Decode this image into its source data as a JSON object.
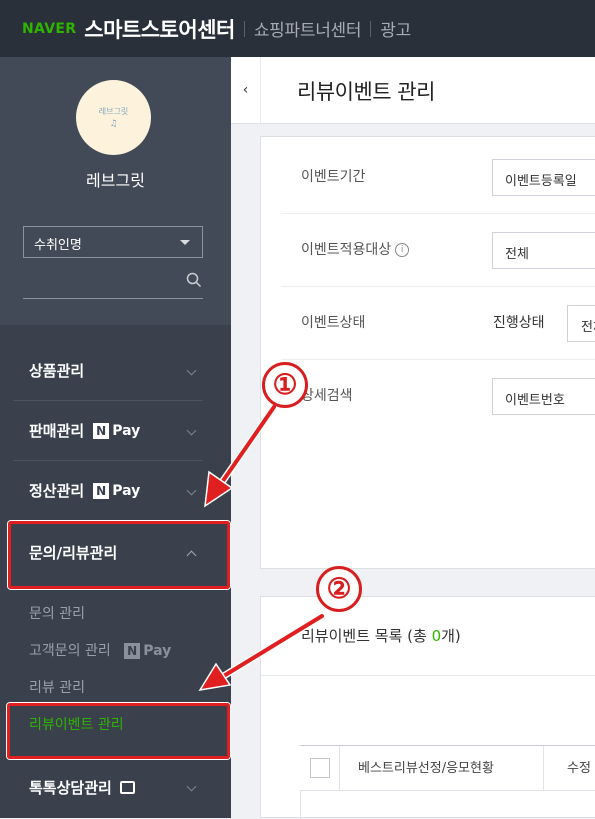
{
  "topbar": {
    "brand": "NAVER",
    "app_name": "스마트스토어센터",
    "links": [
      "쇼핑파트너센터",
      "광고"
    ]
  },
  "sidebar": {
    "avatar_text": "레브그릿",
    "avatar_mark": "♫",
    "store_name": "레브그릿",
    "select_value": "수취인명",
    "menu": [
      {
        "label": "상품관리"
      },
      {
        "label": "판매관리",
        "badge": "Pay"
      },
      {
        "label": "정산관리",
        "badge": "Pay"
      },
      {
        "label": "문의/리뷰관리"
      }
    ],
    "submenu": [
      {
        "label": "문의 관리"
      },
      {
        "label": "고객문의 관리",
        "badge": "Pay"
      },
      {
        "label": "리뷰 관리"
      },
      {
        "label": "리뷰이벤트 관리"
      }
    ],
    "talk_label": "톡톡상담관리",
    "npay_n": "N"
  },
  "main": {
    "collapse_glyph": "‹",
    "page_title": "리뷰이벤트 관리",
    "filters": {
      "period_label": "이벤트기간",
      "period_value": "이벤트등록일",
      "target_label": "이벤트적용대상",
      "target_value": "전체",
      "status_label": "이벤트상태",
      "status_sub_label": "진행상태",
      "status_value": "전체",
      "search_label": "상세검색",
      "search_value": "이벤트번호"
    },
    "list": {
      "title_prefix": "리뷰이벤트 목록 (총 ",
      "count": "0",
      "title_suffix": "개)",
      "columns": [
        "베스트리뷰선정/응모현황",
        "수정"
      ]
    }
  },
  "annotations": {
    "marker1": "①",
    "marker2": "②",
    "color": "#e02020"
  }
}
